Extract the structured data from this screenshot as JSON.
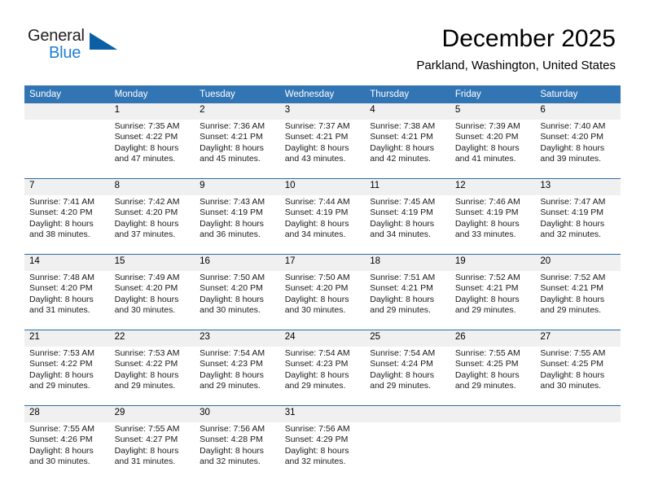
{
  "logo": {
    "word_top": "General",
    "word_bottom": "Blue",
    "triangle_color": "#0b5fa5",
    "blue_text_color": "#1c7fd4"
  },
  "header": {
    "title": "December 2025",
    "location": "Parkland, Washington, United States"
  },
  "theme": {
    "header_band": "#3175b4",
    "week_separator": "#2a6ca8",
    "daynum_band": "#f0f0f0"
  },
  "weekdays": [
    "Sunday",
    "Monday",
    "Tuesday",
    "Wednesday",
    "Thursday",
    "Friday",
    "Saturday"
  ],
  "weeks": [
    [
      {
        "day": "",
        "lines": []
      },
      {
        "day": "1",
        "lines": [
          "Sunrise: 7:35 AM",
          "Sunset: 4:22 PM",
          "Daylight: 8 hours",
          "and 47 minutes."
        ]
      },
      {
        "day": "2",
        "lines": [
          "Sunrise: 7:36 AM",
          "Sunset: 4:21 PM",
          "Daylight: 8 hours",
          "and 45 minutes."
        ]
      },
      {
        "day": "3",
        "lines": [
          "Sunrise: 7:37 AM",
          "Sunset: 4:21 PM",
          "Daylight: 8 hours",
          "and 43 minutes."
        ]
      },
      {
        "day": "4",
        "lines": [
          "Sunrise: 7:38 AM",
          "Sunset: 4:21 PM",
          "Daylight: 8 hours",
          "and 42 minutes."
        ]
      },
      {
        "day": "5",
        "lines": [
          "Sunrise: 7:39 AM",
          "Sunset: 4:20 PM",
          "Daylight: 8 hours",
          "and 41 minutes."
        ]
      },
      {
        "day": "6",
        "lines": [
          "Sunrise: 7:40 AM",
          "Sunset: 4:20 PM",
          "Daylight: 8 hours",
          "and 39 minutes."
        ]
      }
    ],
    [
      {
        "day": "7",
        "lines": [
          "Sunrise: 7:41 AM",
          "Sunset: 4:20 PM",
          "Daylight: 8 hours",
          "and 38 minutes."
        ]
      },
      {
        "day": "8",
        "lines": [
          "Sunrise: 7:42 AM",
          "Sunset: 4:20 PM",
          "Daylight: 8 hours",
          "and 37 minutes."
        ]
      },
      {
        "day": "9",
        "lines": [
          "Sunrise: 7:43 AM",
          "Sunset: 4:19 PM",
          "Daylight: 8 hours",
          "and 36 minutes."
        ]
      },
      {
        "day": "10",
        "lines": [
          "Sunrise: 7:44 AM",
          "Sunset: 4:19 PM",
          "Daylight: 8 hours",
          "and 34 minutes."
        ]
      },
      {
        "day": "11",
        "lines": [
          "Sunrise: 7:45 AM",
          "Sunset: 4:19 PM",
          "Daylight: 8 hours",
          "and 34 minutes."
        ]
      },
      {
        "day": "12",
        "lines": [
          "Sunrise: 7:46 AM",
          "Sunset: 4:19 PM",
          "Daylight: 8 hours",
          "and 33 minutes."
        ]
      },
      {
        "day": "13",
        "lines": [
          "Sunrise: 7:47 AM",
          "Sunset: 4:19 PM",
          "Daylight: 8 hours",
          "and 32 minutes."
        ]
      }
    ],
    [
      {
        "day": "14",
        "lines": [
          "Sunrise: 7:48 AM",
          "Sunset: 4:20 PM",
          "Daylight: 8 hours",
          "and 31 minutes."
        ]
      },
      {
        "day": "15",
        "lines": [
          "Sunrise: 7:49 AM",
          "Sunset: 4:20 PM",
          "Daylight: 8 hours",
          "and 30 minutes."
        ]
      },
      {
        "day": "16",
        "lines": [
          "Sunrise: 7:50 AM",
          "Sunset: 4:20 PM",
          "Daylight: 8 hours",
          "and 30 minutes."
        ]
      },
      {
        "day": "17",
        "lines": [
          "Sunrise: 7:50 AM",
          "Sunset: 4:20 PM",
          "Daylight: 8 hours",
          "and 30 minutes."
        ]
      },
      {
        "day": "18",
        "lines": [
          "Sunrise: 7:51 AM",
          "Sunset: 4:21 PM",
          "Daylight: 8 hours",
          "and 29 minutes."
        ]
      },
      {
        "day": "19",
        "lines": [
          "Sunrise: 7:52 AM",
          "Sunset: 4:21 PM",
          "Daylight: 8 hours",
          "and 29 minutes."
        ]
      },
      {
        "day": "20",
        "lines": [
          "Sunrise: 7:52 AM",
          "Sunset: 4:21 PM",
          "Daylight: 8 hours",
          "and 29 minutes."
        ]
      }
    ],
    [
      {
        "day": "21",
        "lines": [
          "Sunrise: 7:53 AM",
          "Sunset: 4:22 PM",
          "Daylight: 8 hours",
          "and 29 minutes."
        ]
      },
      {
        "day": "22",
        "lines": [
          "Sunrise: 7:53 AM",
          "Sunset: 4:22 PM",
          "Daylight: 8 hours",
          "and 29 minutes."
        ]
      },
      {
        "day": "23",
        "lines": [
          "Sunrise: 7:54 AM",
          "Sunset: 4:23 PM",
          "Daylight: 8 hours",
          "and 29 minutes."
        ]
      },
      {
        "day": "24",
        "lines": [
          "Sunrise: 7:54 AM",
          "Sunset: 4:23 PM",
          "Daylight: 8 hours",
          "and 29 minutes."
        ]
      },
      {
        "day": "25",
        "lines": [
          "Sunrise: 7:54 AM",
          "Sunset: 4:24 PM",
          "Daylight: 8 hours",
          "and 29 minutes."
        ]
      },
      {
        "day": "26",
        "lines": [
          "Sunrise: 7:55 AM",
          "Sunset: 4:25 PM",
          "Daylight: 8 hours",
          "and 29 minutes."
        ]
      },
      {
        "day": "27",
        "lines": [
          "Sunrise: 7:55 AM",
          "Sunset: 4:25 PM",
          "Daylight: 8 hours",
          "and 30 minutes."
        ]
      }
    ],
    [
      {
        "day": "28",
        "lines": [
          "Sunrise: 7:55 AM",
          "Sunset: 4:26 PM",
          "Daylight: 8 hours",
          "and 30 minutes."
        ]
      },
      {
        "day": "29",
        "lines": [
          "Sunrise: 7:55 AM",
          "Sunset: 4:27 PM",
          "Daylight: 8 hours",
          "and 31 minutes."
        ]
      },
      {
        "day": "30",
        "lines": [
          "Sunrise: 7:56 AM",
          "Sunset: 4:28 PM",
          "Daylight: 8 hours",
          "and 32 minutes."
        ]
      },
      {
        "day": "31",
        "lines": [
          "Sunrise: 7:56 AM",
          "Sunset: 4:29 PM",
          "Daylight: 8 hours",
          "and 32 minutes."
        ]
      },
      {
        "day": "",
        "lines": []
      },
      {
        "day": "",
        "lines": []
      },
      {
        "day": "",
        "lines": []
      }
    ]
  ]
}
